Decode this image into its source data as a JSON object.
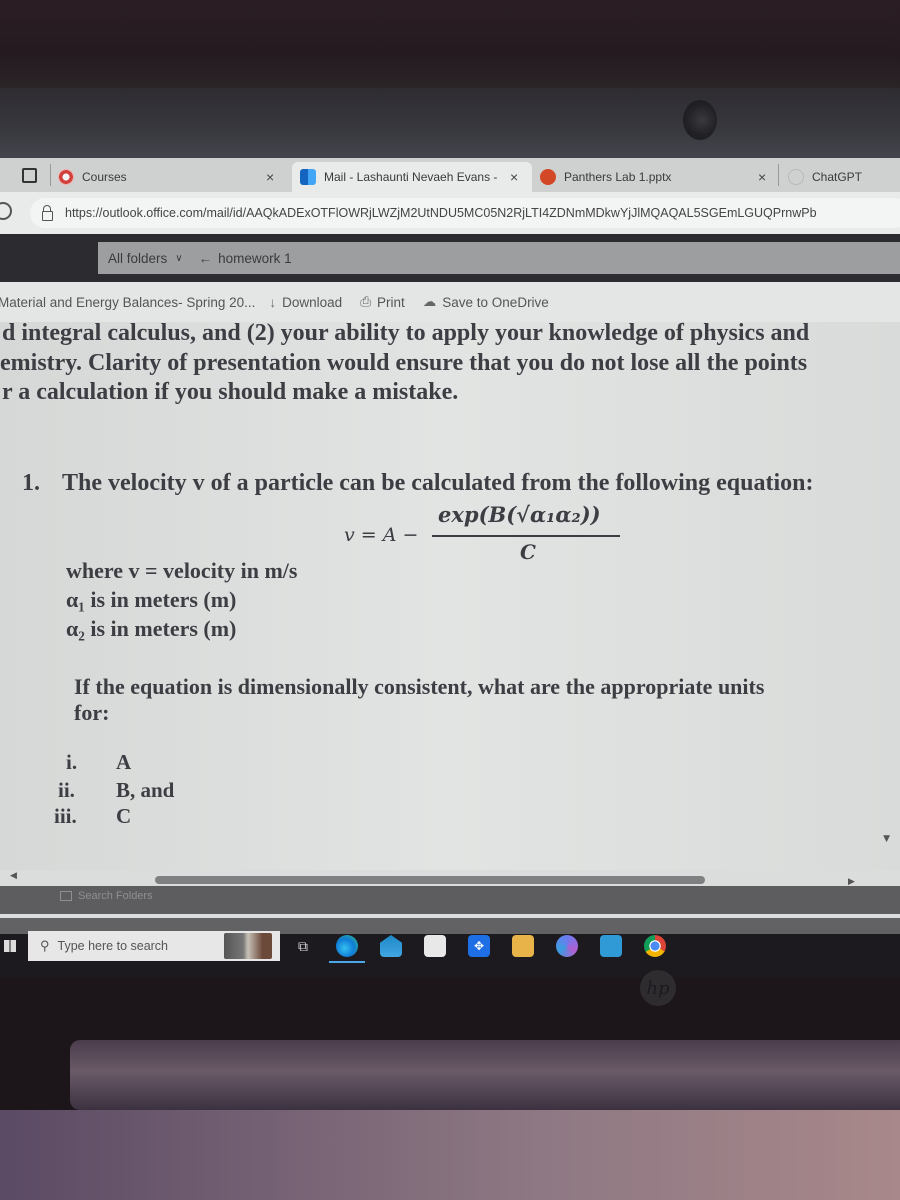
{
  "browser": {
    "tabs": [
      {
        "label": "Courses",
        "icon": "canvas-icon",
        "active": false
      },
      {
        "label": "Mail - Lashaunti Nevaeh Evans -",
        "icon": "outlook-icon",
        "active": true
      },
      {
        "label": "Panthers Lab 1.pptx",
        "icon": "powerpoint-icon",
        "active": false
      },
      {
        "label": "ChatGPT",
        "icon": "chatgpt-icon",
        "active": false
      }
    ],
    "close_glyph": "×",
    "url": "https://outlook.office.com/mail/id/AAQkADExOTFlOWRjLWZjM2UtNDU5MC05N2RjLTI4ZDNmMDkwYjJlMQAQAL5SGEmLGUQPrnwPb"
  },
  "outlook": {
    "folder_dropdown": "All folders",
    "back_label": "homework 1",
    "attachment": {
      "name": "Material and Energy Balances- Spring 20...",
      "download": "Download",
      "print": "Print",
      "save": "Save to OneDrive"
    },
    "search_folders": "Search Folders"
  },
  "document": {
    "intro_lines": [
      "d integral calculus, and (2) your ability to apply your knowledge of physics and",
      "emistry. Clarity of presentation would ensure that you do not lose all the points",
      "r a calculation if you should make a mistake."
    ],
    "question_number": "1.",
    "question_text": "The velocity v of a particle can be calculated from the following equation:",
    "equation": {
      "lhs": "v = A −",
      "numerator": "exp(B(√α₁α₂))",
      "denominator": "C"
    },
    "definitions": [
      "where v = velocity in m/s",
      "α₁ is in meters (m)",
      "α₂ is in meters (m)"
    ],
    "prompt_lines": [
      "If the equation is dimensionally consistent, what are the appropriate units",
      "for:"
    ],
    "sub_items": [
      {
        "num": "i.",
        "text": "A"
      },
      {
        "num": "ii.",
        "text": "B, and"
      },
      {
        "num": "iii.",
        "text": "C"
      }
    ]
  },
  "taskbar": {
    "search_placeholder": "Type here to search",
    "pinned": [
      "task-view",
      "edge",
      "mail",
      "store",
      "dropbox",
      "file-explorer",
      "copilot",
      "audio-app",
      "chrome"
    ]
  },
  "device": {
    "brand": "hp"
  }
}
